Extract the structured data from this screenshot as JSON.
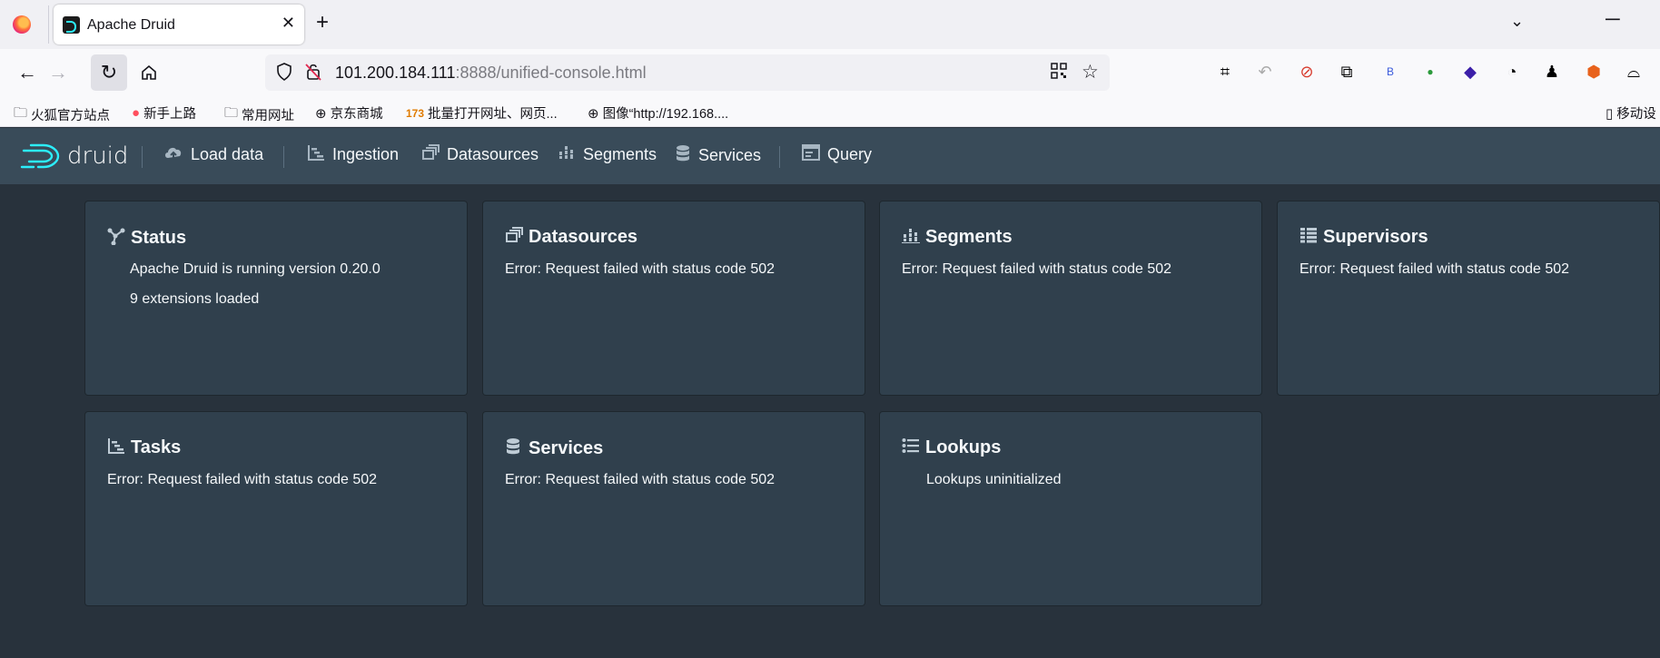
{
  "browser": {
    "tab_title": "Apache Druid",
    "url_host": "101.200.184.111",
    "url_rest": ":8888/unified-console.html",
    "bookmarks": [
      "火狐官方站点",
      "新手上路",
      "常用网址",
      "京东商城",
      "批量打开网址、网页...",
      "图像“http://192.168....",
      "移动设"
    ]
  },
  "druid": {
    "logo_text": "druid",
    "nav": {
      "load_data": "Load data",
      "ingestion": "Ingestion",
      "datasources": "Datasources",
      "segments": "Segments",
      "services": "Services",
      "query": "Query"
    }
  },
  "cards": {
    "status": {
      "title": "Status",
      "line1": "Apache Druid is running version 0.20.0",
      "line2": "9 extensions loaded"
    },
    "datasources": {
      "title": "Datasources",
      "line1": "Error: Request failed with status code 502"
    },
    "segments": {
      "title": "Segments",
      "line1": "Error: Request failed with status code 502"
    },
    "supervisors": {
      "title": "Supervisors",
      "line1": "Error: Request failed with status code 502"
    },
    "tasks": {
      "title": "Tasks",
      "line1": "Error: Request failed with status code 502"
    },
    "services": {
      "title": "Services",
      "line1": "Error: Request failed with status code 502"
    },
    "lookups": {
      "title": "Lookups",
      "line1": "Lookups uninitialized"
    }
  },
  "colors": {
    "header_bg": "#394b59",
    "page_bg": "#28323c",
    "card_bg": "#30404d",
    "logo_accent": "#2ceefb"
  }
}
